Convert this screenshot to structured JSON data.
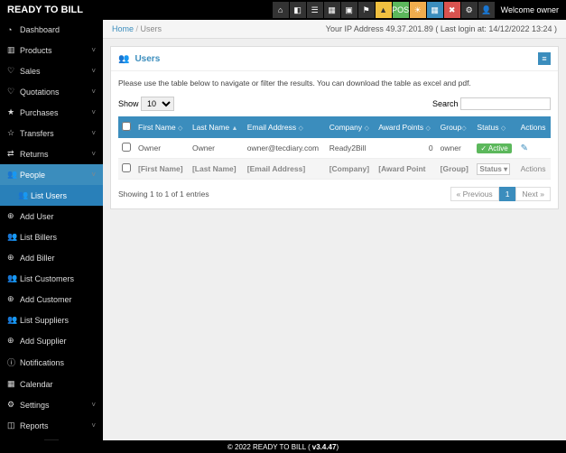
{
  "brand": "READY TO BILL",
  "welcome": "Welcome owner",
  "pos_label": "POS",
  "breadcrumb": {
    "home": "Home",
    "page": "Users",
    "ip": "Your IP Address 49.37.201.89 ( Last login at: 14/12/2022 13:24 )"
  },
  "sidebar": {
    "items": [
      {
        "label": "Dashboard",
        "chev": ""
      },
      {
        "label": "Products",
        "chev": "˅"
      },
      {
        "label": "Sales",
        "chev": "˅"
      },
      {
        "label": "Quotations",
        "chev": "˅"
      },
      {
        "label": "Purchases",
        "chev": "˅"
      },
      {
        "label": "Transfers",
        "chev": "˅"
      },
      {
        "label": "Returns",
        "chev": "˅"
      },
      {
        "label": "People",
        "chev": "˅"
      },
      {
        "label": "List Users",
        "chev": ""
      },
      {
        "label": "Add User",
        "chev": ""
      },
      {
        "label": "List Billers",
        "chev": ""
      },
      {
        "label": "Add Biller",
        "chev": ""
      },
      {
        "label": "List Customers",
        "chev": ""
      },
      {
        "label": "Add Customer",
        "chev": ""
      },
      {
        "label": "List Suppliers",
        "chev": ""
      },
      {
        "label": "Add Supplier",
        "chev": ""
      },
      {
        "label": "Notifications",
        "chev": ""
      },
      {
        "label": "Calendar",
        "chev": ""
      },
      {
        "label": "Settings",
        "chev": "˅"
      },
      {
        "label": "Reports",
        "chev": "˅"
      }
    ]
  },
  "panel": {
    "title": "Users",
    "hint": "Please use the table below to navigate or filter the results. You can download the table as excel and pdf.",
    "show_label": "Show",
    "show_value": "10",
    "search_label": "Search",
    "headers": [
      "First Name",
      "Last Name",
      "Email Address",
      "Company",
      "Award Points",
      "Group",
      "Status",
      "Actions"
    ],
    "row": {
      "first": "Owner",
      "last": "Owner",
      "email": "owner@tecdiary.com",
      "company": "Ready2Bill",
      "points": "0",
      "group": "owner",
      "status": "✓ Active"
    },
    "filter_row": {
      "first": "[First Name]",
      "last": "[Last Name]",
      "email": "[Email Address]",
      "company": "[Company]",
      "points": "[Award Point",
      "group": "[Group]",
      "status": "Status",
      "actions": "Actions"
    },
    "info": "Showing 1 to 1 of 1 entries",
    "pager": {
      "prev": "« Previous",
      "page": "1",
      "next": "Next »"
    }
  },
  "footer": "© 2022 READY TO BILL (",
  "version": "v3.4.47",
  "footer_end": ")"
}
